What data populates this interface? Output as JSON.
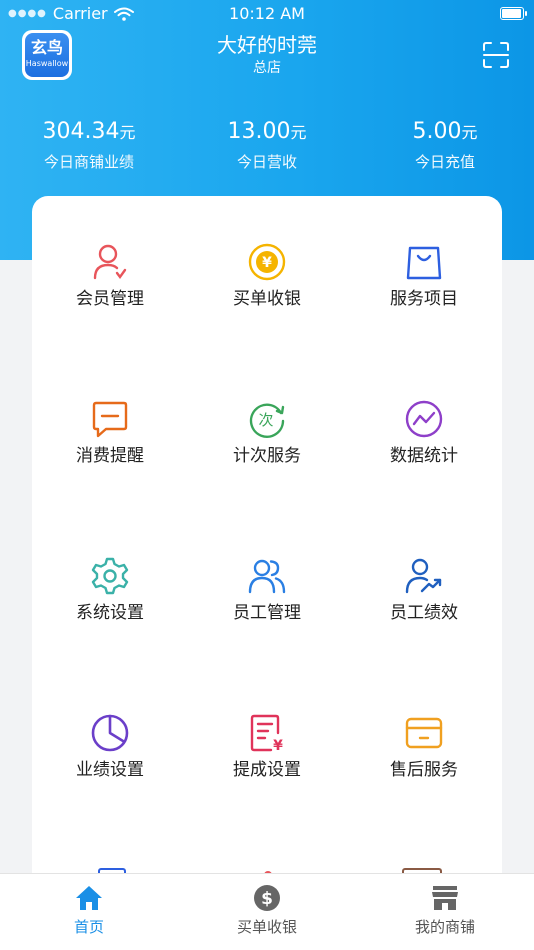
{
  "status_bar": {
    "carrier": "Carrier",
    "time": "10:12 AM"
  },
  "logo": {
    "title": "玄鸟",
    "subtitle": "Haswallow"
  },
  "store": {
    "name": "大好的时莞",
    "branch": "总店"
  },
  "stats": [
    {
      "value": "304.34",
      "unit": "元",
      "label": "今日商铺业绩"
    },
    {
      "value": "13.00",
      "unit": "元",
      "label": "今日营收"
    },
    {
      "value": "5.00",
      "unit": "元",
      "label": "今日充值"
    }
  ],
  "grid": [
    {
      "label": "会员管理",
      "icon": "member-icon",
      "color": "#e8555b"
    },
    {
      "label": "买单收银",
      "icon": "yuan-coin-icon",
      "color": "#f5b400"
    },
    {
      "label": "服务项目",
      "icon": "shopping-bag-icon",
      "color": "#2d5fe0"
    },
    {
      "label": "消费提醒",
      "icon": "message-icon",
      "color": "#e66a1a"
    },
    {
      "label": "计次服务",
      "icon": "count-cycle-icon",
      "color": "#3aa55a"
    },
    {
      "label": "数据统计",
      "icon": "trend-circle-icon",
      "color": "#8e3fc9"
    },
    {
      "label": "系统设置",
      "icon": "gear-icon",
      "color": "#3ab1a8"
    },
    {
      "label": "员工管理",
      "icon": "staff-group-icon",
      "color": "#2a7fe3"
    },
    {
      "label": "员工绩效",
      "icon": "staff-performance-icon",
      "color": "#1f5fbf"
    },
    {
      "label": "业绩设置",
      "icon": "pie-chart-icon",
      "color": "#6b3fc9"
    },
    {
      "label": "提成设置",
      "icon": "commission-icon",
      "color": "#e0335a"
    },
    {
      "label": "售后服务",
      "icon": "card-icon",
      "color": "#f0a020"
    }
  ],
  "tabs": [
    {
      "label": "首页",
      "icon": "home-icon",
      "active": true
    },
    {
      "label": "买单收银",
      "icon": "dollar-coin-icon",
      "active": false
    },
    {
      "label": "我的商铺",
      "icon": "store-icon",
      "active": false
    }
  ],
  "colors": {
    "accent": "#1a8fe6",
    "header_start": "#2fb3f3",
    "header_end": "#0c96e6"
  }
}
